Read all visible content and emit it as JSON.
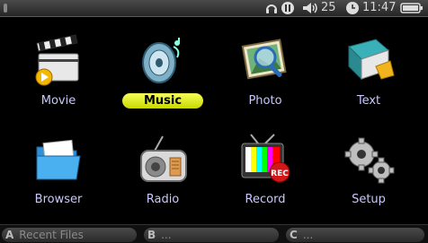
{
  "status": {
    "volume": "25",
    "time": "11:47"
  },
  "menu": {
    "items": [
      {
        "label": "Movie",
        "icon": "clapperboard-icon"
      },
      {
        "label": "Music",
        "icon": "speaker-icon",
        "selected": true
      },
      {
        "label": "Photo",
        "icon": "magnifier-picture-icon"
      },
      {
        "label": "Text",
        "icon": "book-icon"
      },
      {
        "label": "Browser",
        "icon": "folder-icon"
      },
      {
        "label": "Radio",
        "icon": "radio-icon"
      },
      {
        "label": "Record",
        "icon": "tv-rec-icon"
      },
      {
        "label": "Setup",
        "icon": "gears-icon"
      }
    ]
  },
  "softkeys": [
    {
      "key": "A",
      "label": "Recent Files"
    },
    {
      "key": "B",
      "label": "..."
    },
    {
      "key": "C",
      "label": "..."
    }
  ],
  "colors": {
    "selection": "#e4f02a",
    "label": "#c8c8ff",
    "background": "#000000"
  }
}
